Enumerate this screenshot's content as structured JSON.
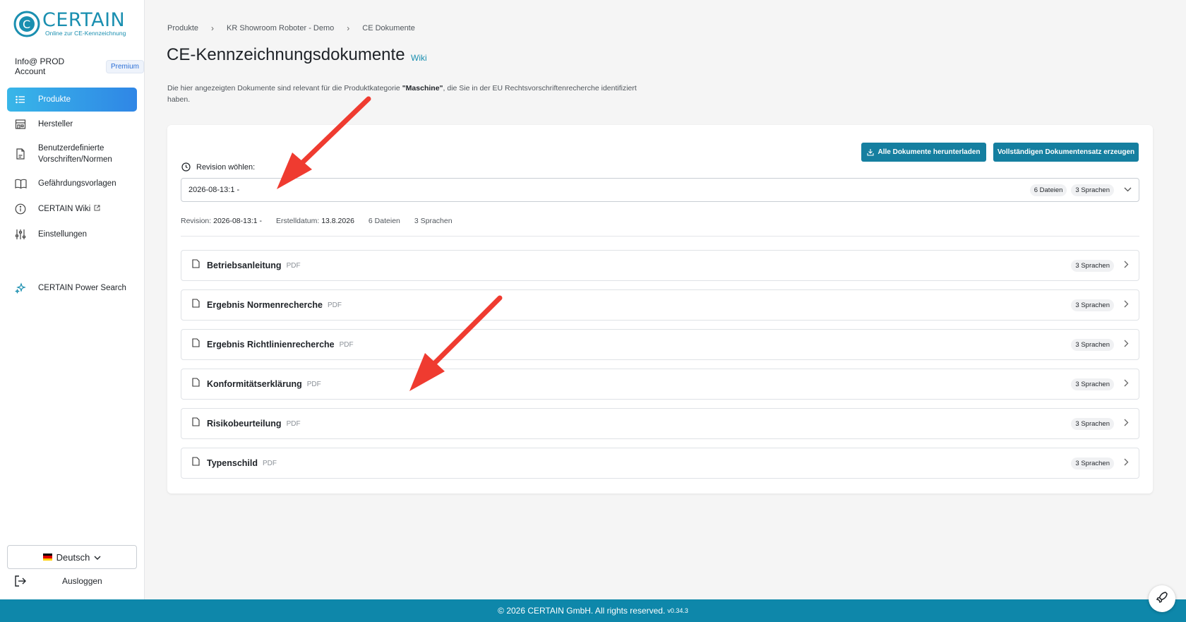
{
  "brand": {
    "name": "CERTAIN",
    "tagline": "Online zur CE-Kennzeichnung",
    "color": "#1a8fb0"
  },
  "account": {
    "name": "Info@ PROD Account",
    "plan": "Premium"
  },
  "nav": [
    {
      "label": "Produkte",
      "icon": "list-icon",
      "active": true
    },
    {
      "label": "Hersteller",
      "icon": "factory-icon",
      "active": false
    },
    {
      "label": "Benutzerdefinierte Vorschriften/Normen",
      "icon": "document-icon",
      "active": false
    },
    {
      "label": "Gefährdungsvorlagen",
      "icon": "book-icon",
      "active": false
    },
    {
      "label": "CERTAIN Wiki",
      "icon": "info-icon",
      "active": false
    },
    {
      "label": "Einstellungen",
      "icon": "sliders-icon",
      "active": false
    },
    {
      "label": "CERTAIN Power Search",
      "icon": "sparkles-icon",
      "active": false
    }
  ],
  "language": {
    "selected": "Deutsch"
  },
  "logout_label": "Ausloggen",
  "breadcrumb": [
    "Produkte",
    "KR Showroom Roboter - Demo",
    "CE Dokumente"
  ],
  "page": {
    "title": "CE-Kennzeichnungsdokumente",
    "wiki_label": "Wiki",
    "desc_before": "Die hier angezeigten Dokumente sind relevant für die Produktkategorie ",
    "desc_category": "\"Maschine\"",
    "desc_after": ", die Sie in der EU Rechtsvorschriftenrecherche identifiziert haben."
  },
  "actions": {
    "download_all": "Alle Dokumente herunterladen",
    "generate_full": "Vollständigen Dokumentensatz erzeugen"
  },
  "revision": {
    "label": "Revision wöhlen:",
    "selected": "2026-08-13:1 -",
    "files_chip": "6 Dateien",
    "languages_chip": "3 Sprachen"
  },
  "meta": {
    "revision_label": "Revision:",
    "revision_value": "2026-08-13:1 -",
    "created_label": "Erstelldatum:",
    "created_value": "13.8.2026",
    "files": "6 Dateien",
    "languages": "3 Sprachen"
  },
  "documents": [
    {
      "name": "Betriebsanleitung",
      "type": "PDF",
      "languages": "3 Sprachen"
    },
    {
      "name": "Ergebnis Normenrecherche",
      "type": "PDF",
      "languages": "3 Sprachen"
    },
    {
      "name": "Ergebnis Richtlinienrecherche",
      "type": "PDF",
      "languages": "3 Sprachen"
    },
    {
      "name": "Konformitätserklärung",
      "type": "PDF",
      "languages": "3 Sprachen"
    },
    {
      "name": "Risikobeurteilung",
      "type": "PDF",
      "languages": "3 Sprachen"
    },
    {
      "name": "Typenschild",
      "type": "PDF",
      "languages": "3 Sprachen"
    }
  ],
  "footer": {
    "copyright": "© 2026 CERTAIN GmbH. All rights reserved.",
    "version": "v0.34.3"
  },
  "colors": {
    "accent": "#157fa0",
    "footer": "#0e87aa",
    "annotation_arrow": "#ef3b30"
  }
}
